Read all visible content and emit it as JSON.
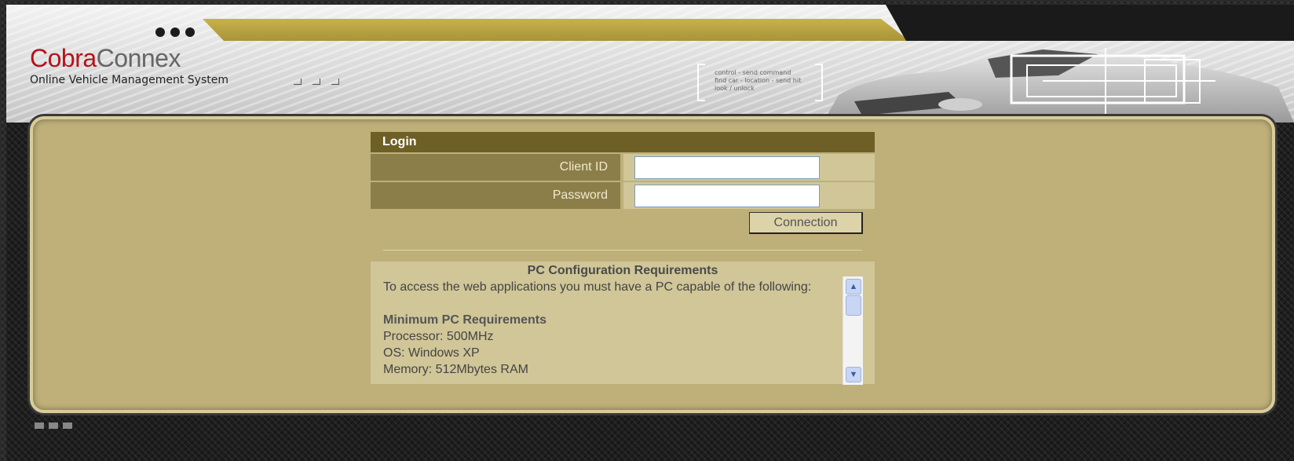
{
  "header": {
    "logo_part1": "Cobra",
    "logo_part2": "Connex",
    "subtitle": "Online Vehicle Management System",
    "command_lines": [
      "control - send command",
      "find car - location - send hit",
      "look / unlock"
    ]
  },
  "login": {
    "title": "Login",
    "client_id_label": "Client ID",
    "client_id_value": "",
    "password_label": "Password",
    "password_value": "",
    "connect_button": "Connection"
  },
  "requirements": {
    "title": "PC Configuration Requirements",
    "intro": "To access the web applications you must have a PC capable of the following:",
    "subtitle": "Minimum PC Requirements",
    "items": [
      "Processor: 500MHz",
      "OS: Windows XP",
      "Memory: 512Mbytes RAM"
    ]
  },
  "colors": {
    "brand_red": "#b5121b",
    "panel_bg": "#bfb07a",
    "login_header": "#6e5f27"
  }
}
